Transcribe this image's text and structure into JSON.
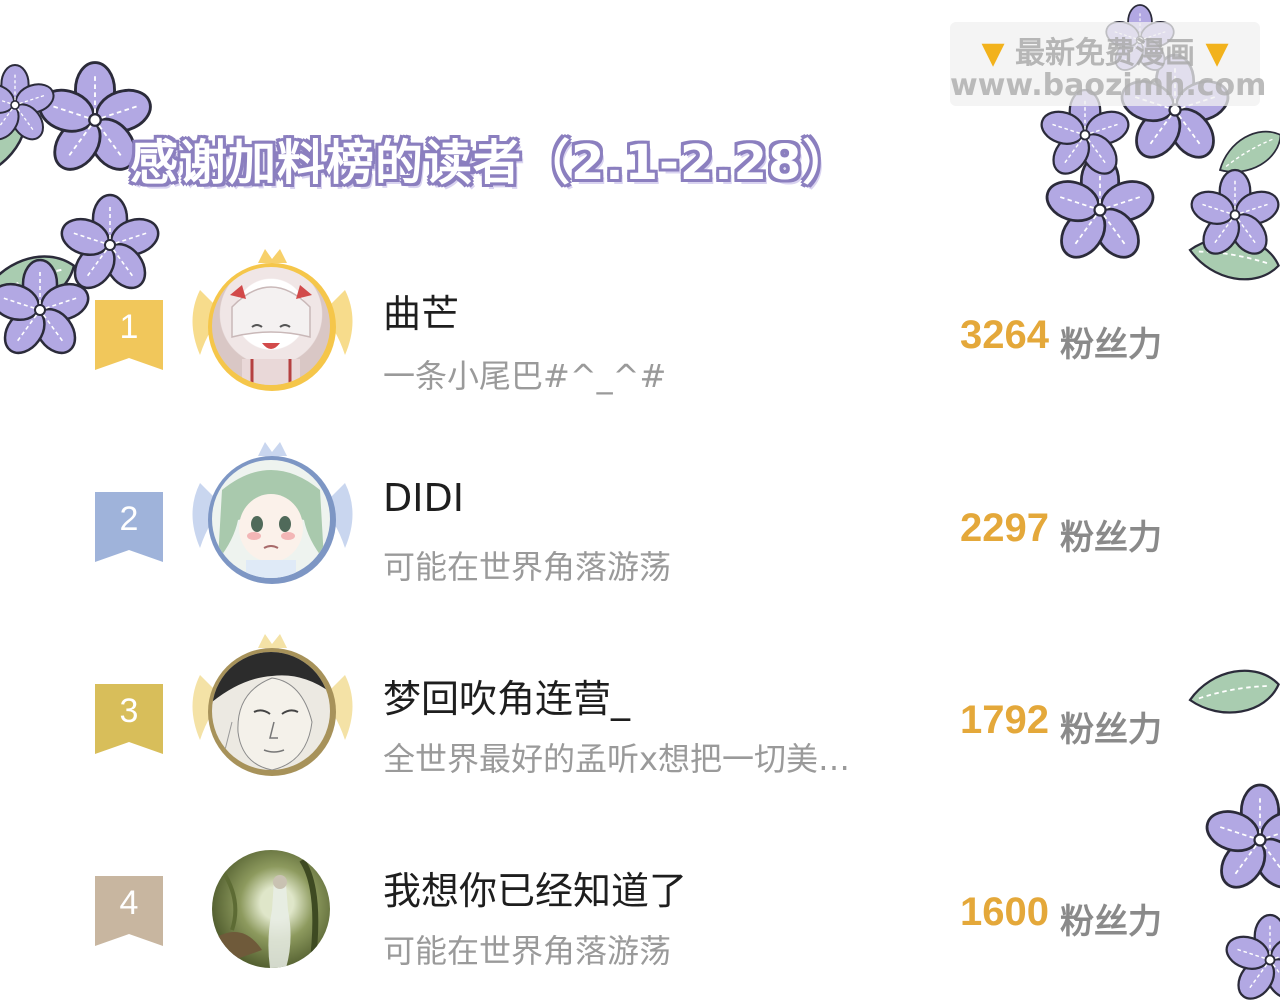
{
  "watermark": {
    "line1": "最新免费漫画",
    "line2": "www.baozimh.com",
    "finger_icon": "pointing-down-hand"
  },
  "title": "感谢加料榜的读者（2.1-2.28）",
  "unit_label": "粉丝力",
  "colors": {
    "gold": "#e4a83a",
    "rank1": "#f1c75b",
    "rank2": "#9fb3da",
    "rank3": "#d8be5a",
    "rank4": "#c8b6a0",
    "flower": "#b2a8e3",
    "leaf": "#a9ccb0"
  },
  "entries": [
    {
      "rank": "1",
      "name": "曲芒",
      "subtitle": "一条小尾巴#^_^#",
      "score": "3264"
    },
    {
      "rank": "2",
      "name": "DIDI",
      "subtitle": "可能在世界角落游荡",
      "score": "2297"
    },
    {
      "rank": "3",
      "name": "梦回吹角连营_",
      "subtitle": "全世界最好的孟听x想把一切美…",
      "score": "1792"
    },
    {
      "rank": "4",
      "name": "我想你已经知道了",
      "subtitle": "可能在世界角落游荡",
      "score": "1600"
    }
  ]
}
